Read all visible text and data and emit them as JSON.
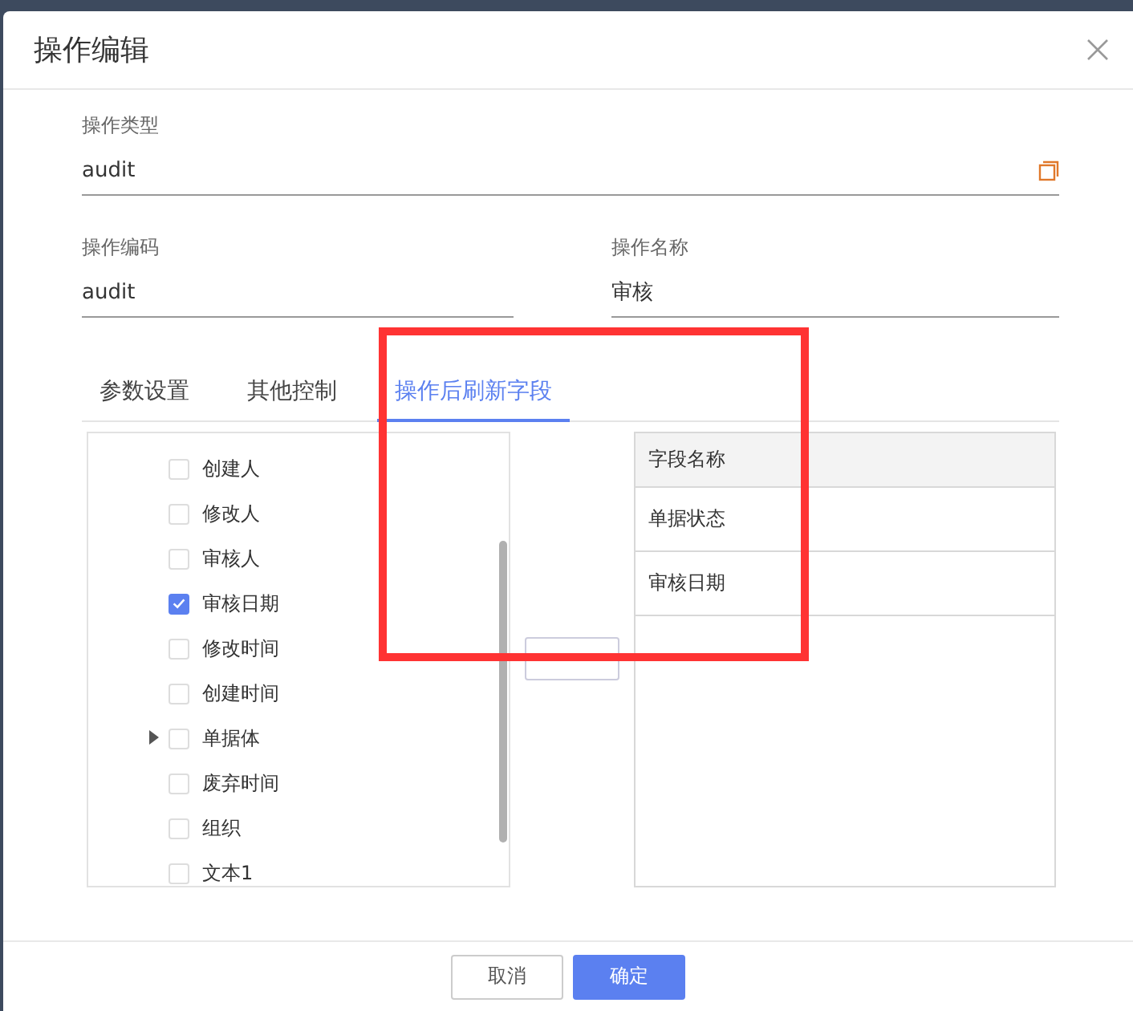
{
  "dialog": {
    "title": "操作编辑"
  },
  "type_field": {
    "label": "操作类型",
    "value": "audit"
  },
  "code_field": {
    "label": "操作编码",
    "value": "audit"
  },
  "name_field": {
    "label": "操作名称",
    "value": "审核"
  },
  "tabs": [
    {
      "label": "参数设置",
      "selected": false
    },
    {
      "label": "其他控制",
      "selected": false
    },
    {
      "label": "操作后刷新字段",
      "selected": true
    }
  ],
  "tree": [
    {
      "label": "创建人",
      "checked": false,
      "kind": "leaf"
    },
    {
      "label": "修改人",
      "checked": false,
      "kind": "leaf"
    },
    {
      "label": "审核人",
      "checked": false,
      "kind": "leaf"
    },
    {
      "label": "审核日期",
      "checked": true,
      "kind": "leaf"
    },
    {
      "label": "修改时间",
      "checked": false,
      "kind": "leaf"
    },
    {
      "label": "创建时间",
      "checked": false,
      "kind": "leaf"
    },
    {
      "label": "单据体",
      "checked": false,
      "kind": "group"
    },
    {
      "label": "废弃时间",
      "checked": false,
      "kind": "leaf"
    },
    {
      "label": "组织",
      "checked": false,
      "kind": "leaf"
    },
    {
      "label": "文本1",
      "checked": false,
      "kind": "leaf"
    }
  ],
  "table": {
    "columns": [
      "字段名称"
    ],
    "rows": [
      [
        "单据状态"
      ],
      [
        "审核日期"
      ]
    ]
  },
  "buttons": [
    {
      "label": "取消",
      "kind": "secondary"
    },
    {
      "label": "确定",
      "kind": "primary"
    }
  ]
}
